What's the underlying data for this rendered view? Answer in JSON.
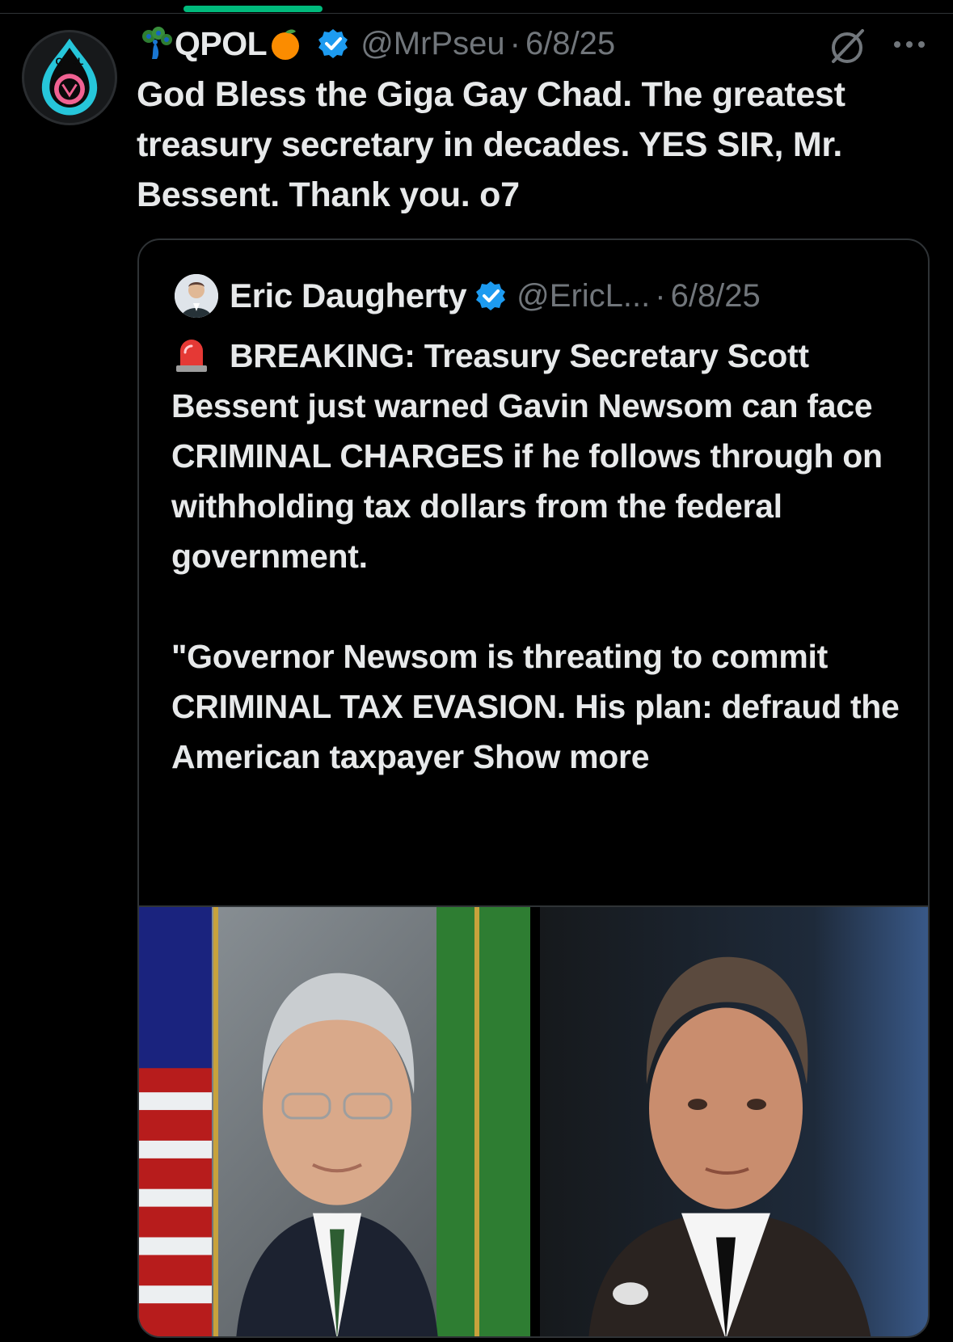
{
  "post": {
    "display_name": "QPOL",
    "handle": "@MrPseu",
    "separator": "·",
    "date": "6/8/25",
    "avatar_label": "QPOL",
    "text": "God Bless the Giga Gay Chad. The greatest treasury secretary in decades. YES SIR, Mr. Bessent. Thank you. o7"
  },
  "quote": {
    "display_name": "Eric Daugherty",
    "handle": "@EricL...",
    "separator": "·",
    "date": "6/8/25",
    "paragraph1": "BREAKING: Treasury Secretary Scott Bessent just warned Gavin Newsom can face CRIMINAL CHARGES if he follows through on withholding tax dollars from the federal government.",
    "paragraph2": "\"Governor Newsom is threating to commit CRIMINAL TAX EVASION. His plan: defraud the American taxpayer",
    "show_more": "Show more"
  },
  "icons": {
    "verified": "verified-badge-icon",
    "grok": "grok-icon",
    "more": "more-options-icon",
    "siren": "siren-emoji-icon",
    "peacock": "peacock-emoji-icon",
    "orange": "orange-emoji-icon"
  },
  "colors": {
    "background": "#000000",
    "text": "#e7e9ea",
    "muted": "#71767b",
    "verified_blue": "#1d9bf0",
    "active_tab": "#00ba7c",
    "border": "#2f3336"
  }
}
